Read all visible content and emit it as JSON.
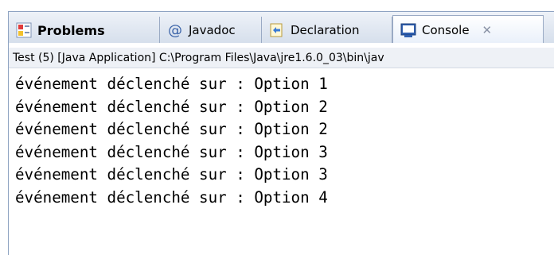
{
  "tabs": [
    {
      "label": "Problems",
      "icon": "problems-icon",
      "active": false
    },
    {
      "label": "Javadoc",
      "icon": "javadoc-at-icon",
      "active": false
    },
    {
      "label": "Declaration",
      "icon": "declaration-icon",
      "active": false
    },
    {
      "label": "Console",
      "icon": "console-icon",
      "active": true,
      "close": "✕"
    }
  ],
  "status": "Test (5) [Java Application] C:\\Program Files\\Java\\jre1.6.0_03\\bin\\jav",
  "console": {
    "lines": [
      "événement déclenché sur : Option 1",
      "événement déclenché sur : Option 2",
      "événement déclenché sur : Option 2",
      "événement déclenché sur : Option 3",
      "événement déclenché sur : Option 3",
      "événement déclenché sur : Option 4"
    ]
  },
  "colors": {
    "tab_border": "#8ea3c2",
    "background": "#ffffff",
    "status_bg": "#eef1f6"
  }
}
